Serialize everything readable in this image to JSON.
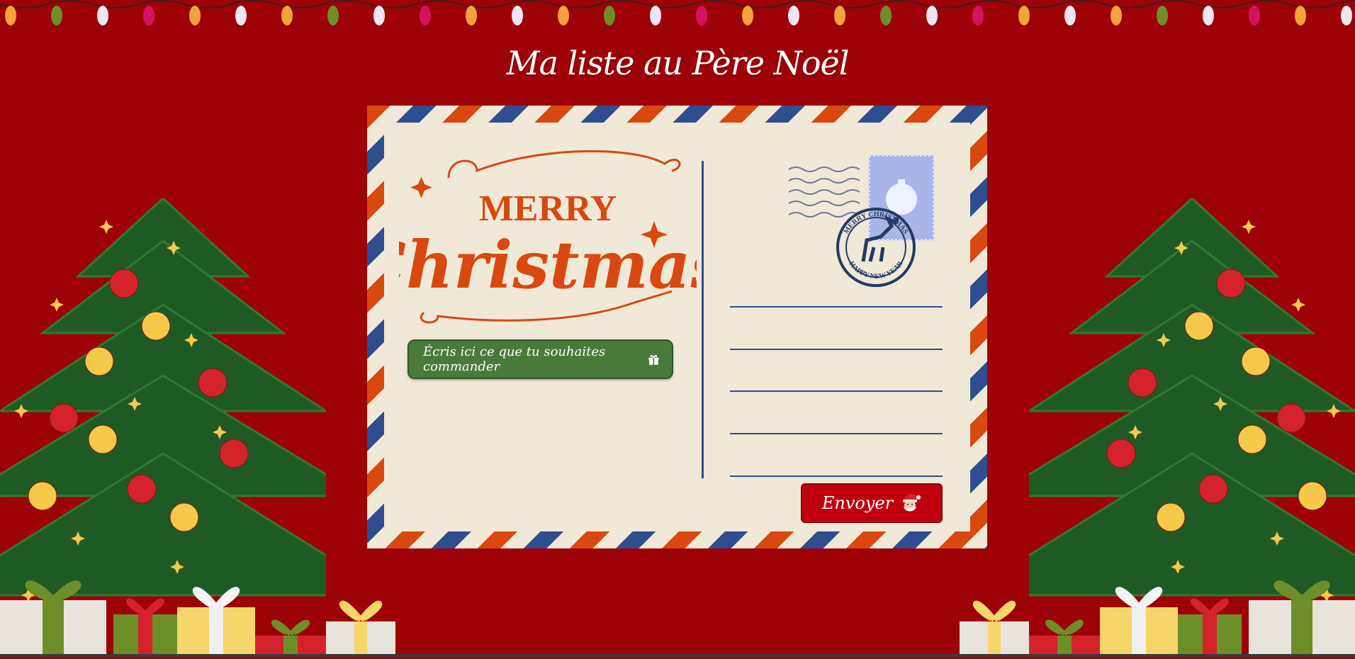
{
  "page": {
    "title": "Ma liste au Père Noël",
    "background_color": "#9d0208"
  },
  "postcard": {
    "headline_top": "MERRY",
    "headline_main": "Christmas",
    "wish_button_label": "Écris ici ce que tu souhaites commander",
    "wish_button_icon": "gift-icon",
    "send_button_label": "Envoyer",
    "send_button_icon": "santa-icon",
    "postmark_top": "MERRY CHRISTMAS",
    "postmark_bottom": "HAPPY NEW YEAR",
    "colors": {
      "card": "#f1e9d8",
      "stripe_red": "#d9480f",
      "stripe_blue": "#2f4d8f",
      "headline": "#d9480f",
      "wish_button": "#4a7a3b",
      "send_button": "#c1000f"
    }
  },
  "decor": {
    "lights": "string-lights",
    "trees": "christmas-tree",
    "gifts": "gift-boxes"
  }
}
